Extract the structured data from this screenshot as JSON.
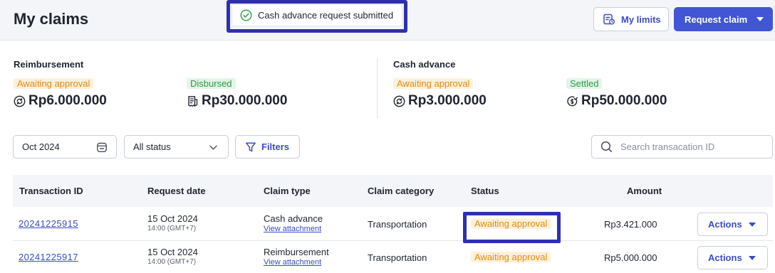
{
  "page": {
    "title": "My claims"
  },
  "toast": {
    "message": "Cash advance request submitted",
    "icon": "check-circle-icon"
  },
  "header": {
    "my_limits_label": "My limits",
    "request_claim_label": "Request claim"
  },
  "summary": {
    "reimbursement": {
      "heading": "Reimbursement",
      "awaiting": {
        "label": "Awaiting approval",
        "amount": "Rp6.000.000"
      },
      "disbursed": {
        "label": "Disbursed",
        "amount": "Rp30.000.000"
      }
    },
    "cash_advance": {
      "heading": "Cash advance",
      "awaiting": {
        "label": "Awaiting approval",
        "amount": "Rp3.000.000"
      },
      "settled": {
        "label": "Settled",
        "amount": "Rp50.000.000"
      }
    }
  },
  "filters": {
    "date_value": "Oct 2024",
    "status_value": "All status",
    "filters_label": "Filters",
    "search_placeholder": "Search transacation ID"
  },
  "table": {
    "columns": {
      "transaction_id": "Transaction ID",
      "request_date": "Request date",
      "claim_type": "Claim type",
      "claim_category": "Claim category",
      "status": "Status",
      "amount": "Amount"
    },
    "rows": [
      {
        "id": "20241225915",
        "date": "15 Oct 2024",
        "time": "14:00 (GMT+7)",
        "type": "Cash advance",
        "attachment": "View attachment",
        "category": "Transportation",
        "status": "Awaiting approval",
        "amount": "Rp3.421.000",
        "action": "Actions"
      },
      {
        "id": "20241225917",
        "date": "15 Oct 2024",
        "time": "14:00 (GMT+7)",
        "type": "Reimbursement",
        "attachment": "View attachment",
        "category": "Transportation",
        "status": "Awaiting approval",
        "amount": "Rp5.000.000",
        "action": "Actions"
      }
    ]
  },
  "colors": {
    "primary": "#4255d4",
    "highlight": "#2f2fb0",
    "pending": "#e58a14",
    "success": "#2e9a4a"
  }
}
